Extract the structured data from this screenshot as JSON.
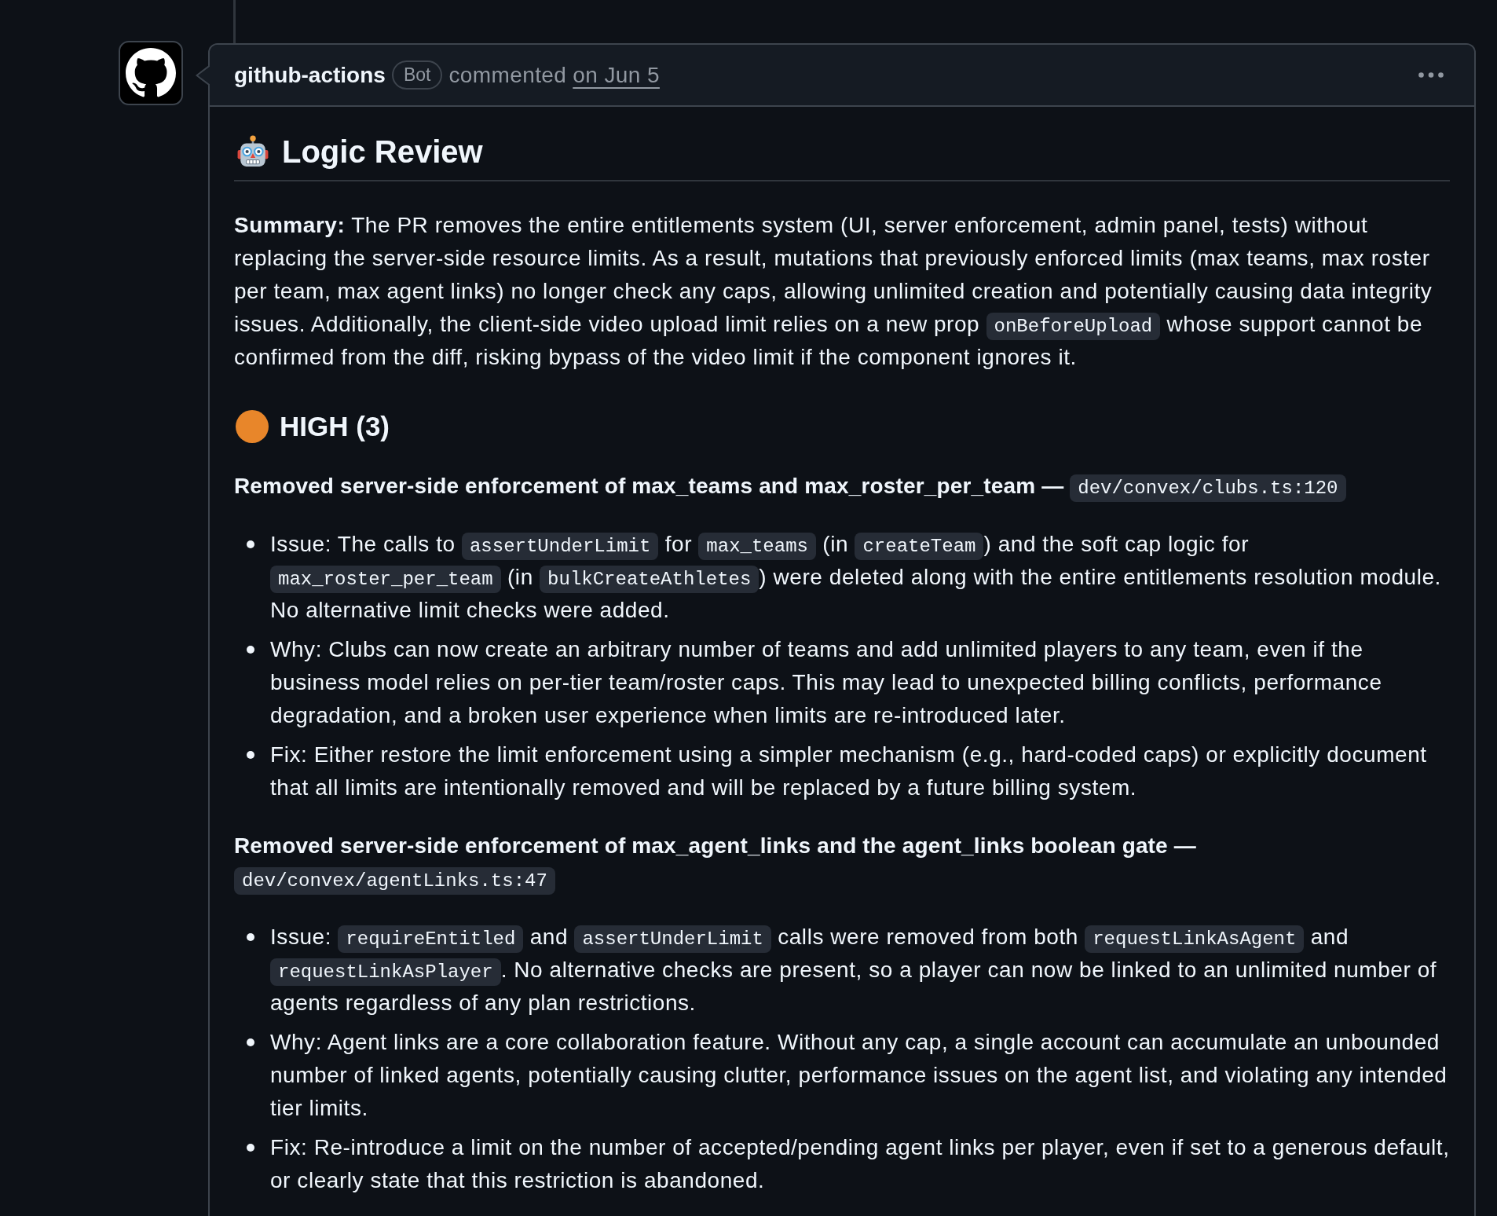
{
  "comment": {
    "author": "github-actions",
    "badge": "Bot",
    "action": "commented",
    "date": "on Jun 5"
  },
  "review": {
    "title": "Logic Review",
    "summary": [
      {
        "kind": "text",
        "text": "**Summary:** The PR removes the entire entitlements system (UI, server enforcement, admin panel, tests) without replacing the server-side resource limits. As a result, mutations that previously enforced limits (max teams, max roster per team, max agent links) no longer check any caps, allowing unlimited creation and potentially causing data integrity issues. Additionally, the client-side video upload limit relies on a new prop "
      },
      {
        "kind": "code",
        "text": "onBeforeUpload"
      },
      {
        "kind": "text",
        "text": " whose support cannot be confirmed from the diff, risking bypass of the video limit if the component ignores it."
      }
    ],
    "sections": [
      {
        "title": "HIGH (3)",
        "color": "#e8862a",
        "findings": [
          {
            "title": "Removed server-side enforcement of max_teams and max_roster_per_team —",
            "location": "dev/convex/clubs.ts:120",
            "bullets": [
              [
                {
                  "kind": "text",
                  "text": "Issue: The calls to "
                },
                {
                  "kind": "code",
                  "text": "assertUnderLimit"
                },
                {
                  "kind": "text",
                  "text": " for "
                },
                {
                  "kind": "code",
                  "text": "max_teams"
                },
                {
                  "kind": "text",
                  "text": " (in "
                },
                {
                  "kind": "code",
                  "text": "createTeam"
                },
                {
                  "kind": "text",
                  "text": ") and the soft cap logic for "
                },
                {
                  "kind": "code",
                  "text": "max_roster_per_team"
                },
                {
                  "kind": "text",
                  "text": " (in "
                },
                {
                  "kind": "code",
                  "text": "bulkCreateAthletes"
                },
                {
                  "kind": "text",
                  "text": ") were deleted along with the entire entitlements resolution module. No alternative limit checks were added."
                }
              ],
              [
                {
                  "kind": "text",
                  "text": "Why: Clubs can now create an arbitrary number of teams and add unlimited players to any team, even if the business model relies on per-tier team/roster caps. This may lead to unexpected billing conflicts, performance degradation, and a broken user experience when limits are re-introduced later."
                }
              ],
              [
                {
                  "kind": "text",
                  "text": "Fix: Either restore the limit enforcement using a simpler mechanism (e.g., hard-coded caps) or explicitly document that all limits are intentionally removed and will be replaced by a future billing system."
                }
              ]
            ]
          },
          {
            "title": "Removed server-side enforcement of max_agent_links and the agent_links boolean gate —",
            "location": "dev/convex/agentLinks.ts:47",
            "bullets": [
              [
                {
                  "kind": "text",
                  "text": "Issue: "
                },
                {
                  "kind": "code",
                  "text": "requireEntitled"
                },
                {
                  "kind": "text",
                  "text": " and "
                },
                {
                  "kind": "code",
                  "text": "assertUnderLimit"
                },
                {
                  "kind": "text",
                  "text": " calls were removed from both "
                },
                {
                  "kind": "code",
                  "text": "requestLinkAsAgent"
                },
                {
                  "kind": "text",
                  "text": " and "
                },
                {
                  "kind": "code",
                  "text": "requestLinkAsPlayer"
                },
                {
                  "kind": "text",
                  "text": ". No alternative checks are present, so a player can now be linked to an unlimited number of agents regardless of any plan restrictions."
                }
              ],
              [
                {
                  "kind": "text",
                  "text": "Why: Agent links are a core collaboration feature. Without any cap, a single account can accumulate an unbounded number of linked agents, potentially causing clutter, performance issues on the agent list, and violating any intended tier limits."
                }
              ],
              [
                {
                  "kind": "text",
                  "text": "Fix: Re-introduce a limit on the number of accepted/pending agent links per player, even if set to a generous default, or clearly state that this restriction is abandoned."
                }
              ]
            ]
          }
        ]
      }
    ]
  }
}
